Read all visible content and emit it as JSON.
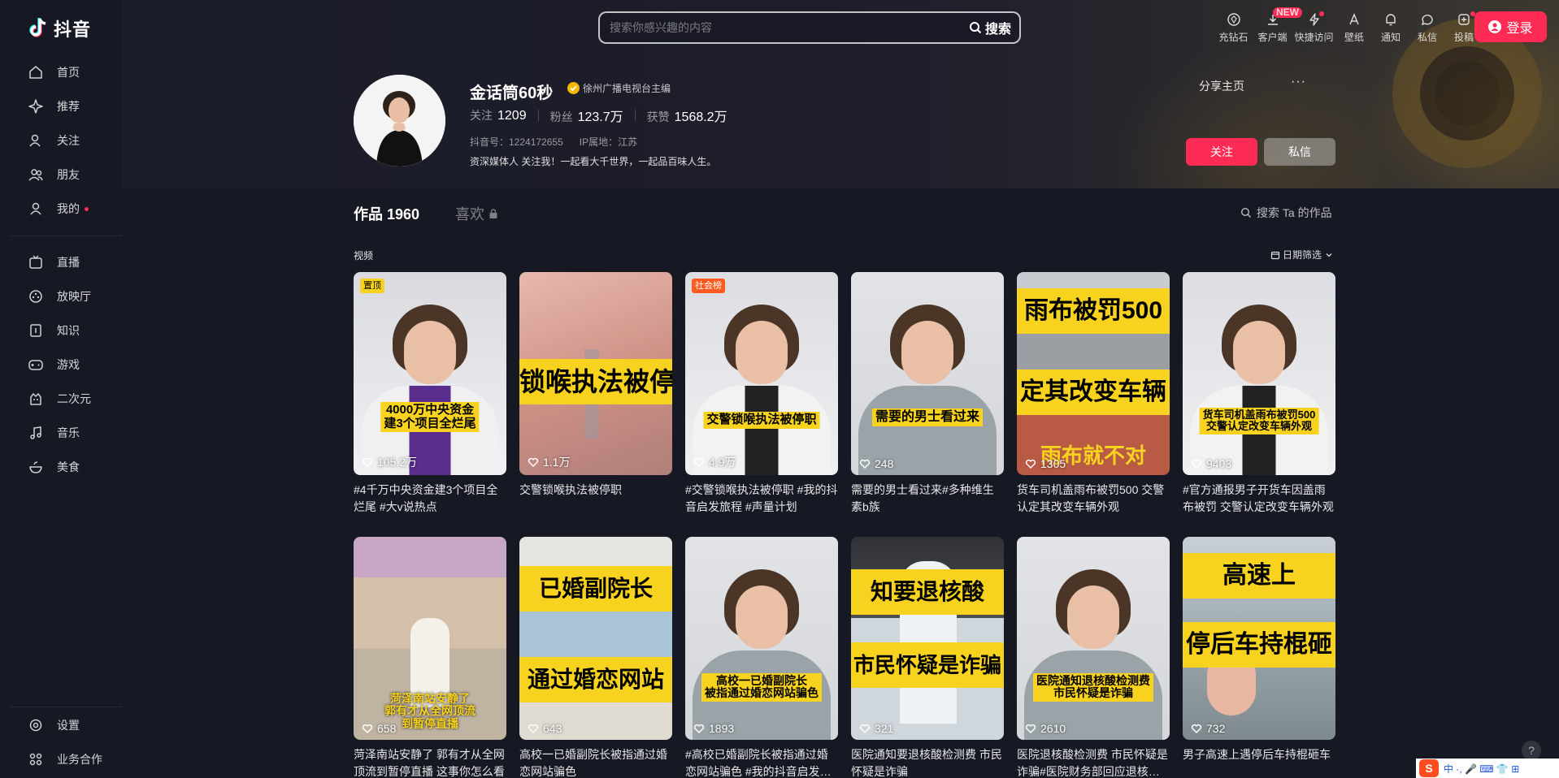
{
  "app": {
    "logo_text": "抖音"
  },
  "sidebar": {
    "items": [
      {
        "label": "首页",
        "icon": "home-icon"
      },
      {
        "label": "推荐",
        "icon": "sparkle-icon"
      },
      {
        "label": "关注",
        "icon": "follow-user-icon"
      },
      {
        "label": "朋友",
        "icon": "friends-icon"
      },
      {
        "label": "我的",
        "icon": "user-icon",
        "dot": true
      }
    ],
    "items2": [
      {
        "label": "直播",
        "icon": "tv-icon"
      },
      {
        "label": "放映厅",
        "icon": "film-reel-icon"
      },
      {
        "label": "知识",
        "icon": "book-icon"
      },
      {
        "label": "游戏",
        "icon": "gamepad-icon"
      },
      {
        "label": "二次元",
        "icon": "anime-icon"
      },
      {
        "label": "音乐",
        "icon": "music-note-icon"
      },
      {
        "label": "美食",
        "icon": "bowl-icon"
      }
    ],
    "bottom": [
      {
        "label": "设置",
        "icon": "gear-icon"
      },
      {
        "label": "业务合作",
        "icon": "grid-icon"
      }
    ]
  },
  "search": {
    "placeholder": "搜索你感兴趣的内容",
    "button_label": "搜索"
  },
  "top_actions": [
    {
      "label": "充钻石",
      "icon": "diamond-icon"
    },
    {
      "label": "客户端",
      "icon": "download-icon",
      "badge": "NEW"
    },
    {
      "label": "快捷访问",
      "icon": "lightning-icon",
      "dot": true
    },
    {
      "label": "壁纸",
      "icon": "wallpaper-icon"
    },
    {
      "label": "通知",
      "icon": "bell-icon"
    },
    {
      "label": "私信",
      "icon": "chat-icon"
    },
    {
      "label": "投稿",
      "icon": "upload-icon",
      "dot": true
    }
  ],
  "login_label": "登录",
  "profile": {
    "name": "金话筒60秒",
    "verification": "徐州广播电视台主编",
    "stats": [
      {
        "label": "关注",
        "value": "1209"
      },
      {
        "label": "粉丝",
        "value": "123.7万"
      },
      {
        "label": "获赞",
        "value": "1568.2万"
      }
    ],
    "douyin_id": "抖音号：1224172655",
    "ip_location": "IP属地：江苏",
    "bio": "资深媒体人 关注我！一起看大千世界，一起品百味人生。",
    "share_label": "分享主页",
    "more_label": "···",
    "follow_label": "关注",
    "message_label": "私信"
  },
  "tabs": {
    "works_label": "作品 1960",
    "likes_label": "喜欢",
    "search_works_label": "搜索 Ta 的作品",
    "section_label": "视频",
    "date_filter_label": "日期筛选"
  },
  "videos": [
    {
      "likes": "105.2万",
      "title": "#4千万中央资金建3个项目全烂尾 #大v说热点",
      "badge": "置顶",
      "overlay": "4000万中央资金\n建3个项目全烂尾",
      "style": "person-purple"
    },
    {
      "likes": "1.1万",
      "title": "交警锁喉执法被停职",
      "overlay": "锁喉执法被停",
      "style": "closeup"
    },
    {
      "likes": "4.9万",
      "title": "#交警锁喉执法被停职 #我的抖音启发旅程 #声量计划",
      "badge": "社会榜",
      "overlay": "交警锁喉执法被停职",
      "style": "person-white"
    },
    {
      "likes": "248",
      "title": "需要的男士看过来#多种维生素b族",
      "overlay": "需要的男士看过来",
      "style": "person-grey"
    },
    {
      "likes": "1305",
      "title": "货车司机盖雨布被罚500 交警认定其改变车辆外观",
      "overlay": "雨布被罚500",
      "overlay2": "定其改变车辆",
      "overlay3": "雨布就不对",
      "style": "truck"
    },
    {
      "likes": "9403",
      "title": "#官方通报男子开货车因盖雨布被罚 交警认定改变车辆外观",
      "overlay": "货车司机盖雨布被罚500\n交警认定改变车辆外观",
      "style": "person-white"
    },
    {
      "likes": "658",
      "title": "菏泽南站安静了 郭有才从全网顶流到暂停直播 这事你怎么看",
      "overlay": "菏泽南站安静了\n郭有才从全网顶流\n到暂停直播",
      "style": "station"
    },
    {
      "likes": "643",
      "title": "高校一已婚副院长被指通过婚恋网站骗色",
      "overlay": "已婚副院长",
      "overlay2": "通过婚恋网站",
      "style": "campus"
    },
    {
      "likes": "1893",
      "title": "#高校已婚副院长被指通过婚恋网站骗色 #我的抖音启发旅程",
      "overlay": "高校一已婚副院长\n被指通过婚恋网站骗色",
      "style": "person-grey"
    },
    {
      "likes": "321",
      "title": "医院通知要退核酸检测费 市民怀疑是诈骗",
      "overlay": "知要退核酸",
      "overlay2": "市民怀疑是诈骗",
      "style": "medic"
    },
    {
      "likes": "2610",
      "title": "医院退核酸检测费 市民怀疑是诈骗#医院财务部回应退核酸检测费",
      "overlay": "医院通知退核酸检测费\n市民怀疑是诈骗",
      "style": "person-grey"
    },
    {
      "likes": "732",
      "title": "男子高速上遇停后车持棍砸车",
      "overlay": "高速上",
      "overlay2": "停后车持棍砸",
      "style": "highway"
    }
  ],
  "ime": {
    "logo": "S",
    "text": "中 ·, 🎤 ⌨ 👕 ⊞"
  },
  "help_label": "?",
  "colors": {
    "accent": "#fe2c55",
    "background": "#161823",
    "overlay_yellow": "#f7d21e"
  }
}
